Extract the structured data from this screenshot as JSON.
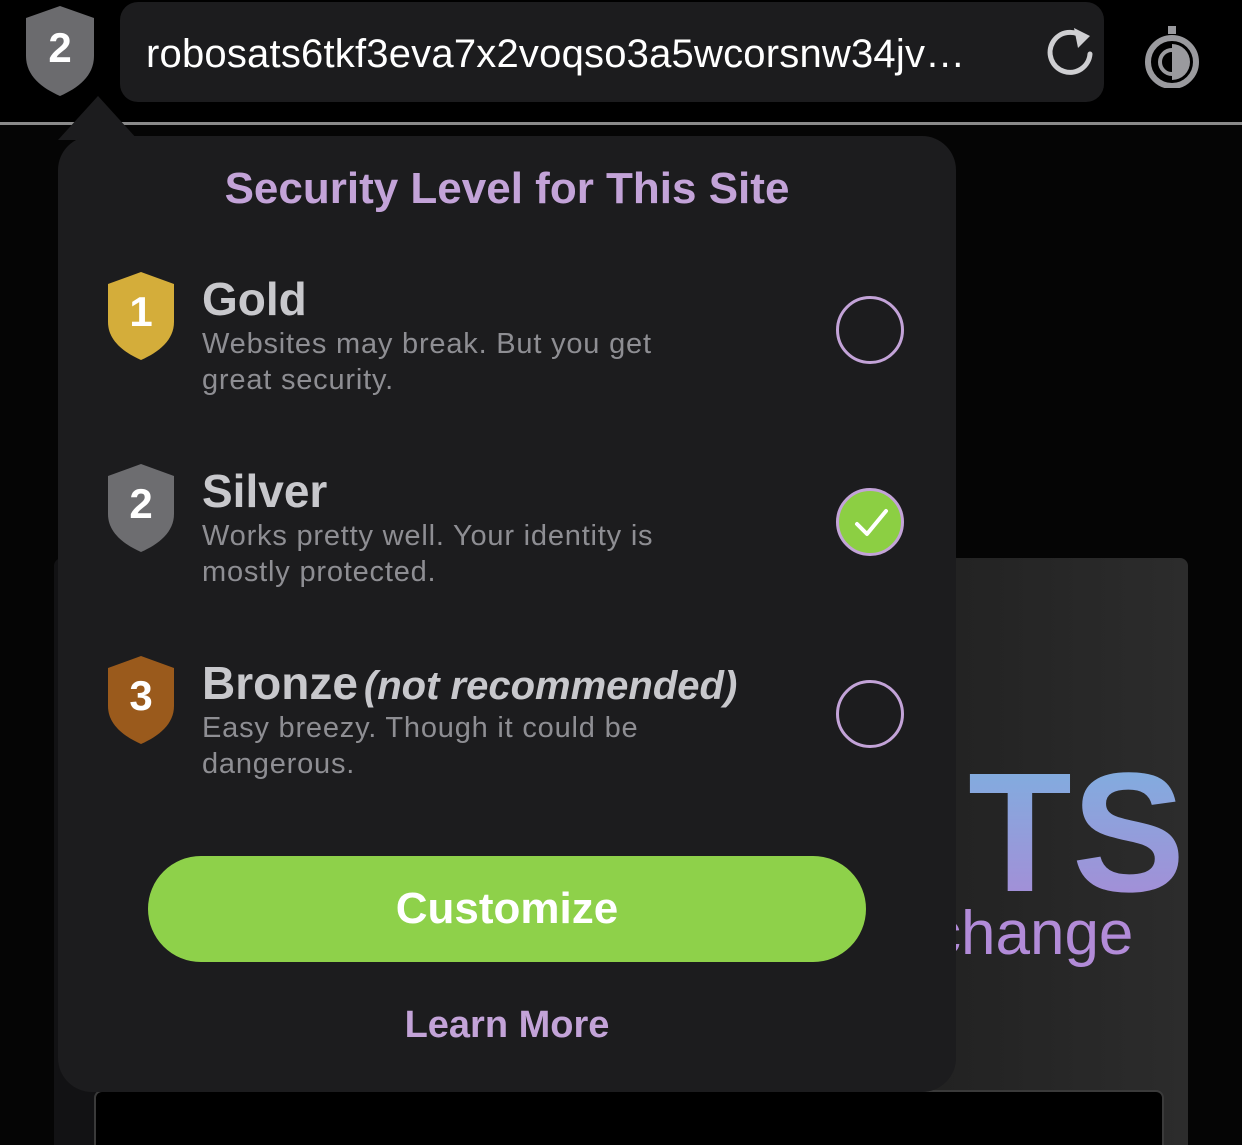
{
  "toolbar": {
    "security_level_number": "2",
    "url": "robosats6tkf3eva7x2voqso3a5wcorsnw34jv…",
    "reload_icon": "reload-icon",
    "onion_icon": "onion-icon"
  },
  "background_page": {
    "logo_fragment": "TS",
    "subtitle_fragment": "change"
  },
  "popover": {
    "title": "Security Level for This Site",
    "levels": [
      {
        "number": "1",
        "name": "Gold",
        "note": "",
        "description": "Websites may break. But you get great security.",
        "color": "#d4ad3a",
        "selected": false
      },
      {
        "number": "2",
        "name": "Silver",
        "note": "",
        "description": "Works pretty well. Your identity is mostly protected.",
        "color": "#6d6d70",
        "selected": true
      },
      {
        "number": "3",
        "name": "Bronze",
        "note": "(not recommended)",
        "description": "Easy breezy. Though it could be dangerous.",
        "color": "#9a5a1c",
        "selected": false
      }
    ],
    "customize_label": "Customize",
    "learn_more_label": "Learn More"
  },
  "colors": {
    "accent_purple": "#c3a3d8",
    "accent_green": "#8ed14a",
    "popover_bg": "#1c1c1e"
  }
}
